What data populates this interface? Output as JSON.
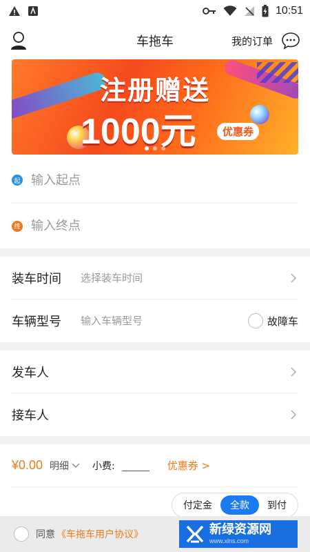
{
  "status_bar": {
    "time": "10:51"
  },
  "header": {
    "title": "车拖车",
    "orders_label": "我的订单"
  },
  "banner": {
    "headline": "注册赠送",
    "amount": "1000元",
    "coupon_tag": "优惠券",
    "page_count": 3,
    "active_page": 1
  },
  "address": {
    "start_badge": "起",
    "start_placeholder": "输入起点",
    "end_badge": "终",
    "end_placeholder": "输入终点"
  },
  "loading": {
    "label": "装车时间",
    "hint": "选择装车时间"
  },
  "vehicle": {
    "label": "车辆型号",
    "placeholder": "输入车辆型号",
    "fault_label": "故障车"
  },
  "sender": {
    "label": "发车人"
  },
  "receiver": {
    "label": "接车人"
  },
  "price": {
    "amount": "¥0.00",
    "detail_label": "明细",
    "tip_label": "小费:",
    "coupon_link": "优惠券 >"
  },
  "payment": {
    "options": [
      "付定金",
      "全款",
      "到付"
    ],
    "selected_index": 1
  },
  "agreement": {
    "prefix": "同意",
    "link": "《车拖车用户协议》"
  },
  "watermark": {
    "cn": "新绿资源网",
    "en": "www.xlns.com"
  },
  "colors": {
    "accent_blue": "#1a7cf0",
    "accent_orange": "#f07a1a",
    "start_blue": "#2a8ee8"
  }
}
